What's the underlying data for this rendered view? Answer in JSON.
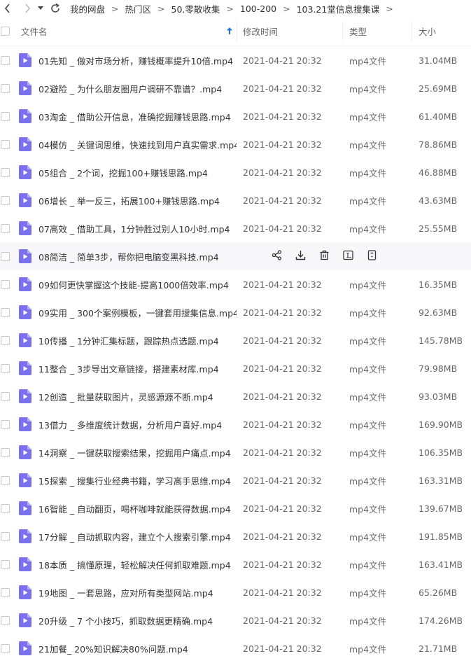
{
  "breadcrumb": [
    "我的网盘",
    "热门区",
    "50.零散收集",
    "100-200",
    "103.21堂信息搜集课"
  ],
  "breadcrumb_separator": ">",
  "columns": {
    "name": "文件名",
    "modified": "修改时间",
    "type": "类型",
    "size": "大小"
  },
  "files": [
    {
      "name": "01先知 _ 做对市场分析，赚钱概率提升10倍.mp4",
      "modified": "2021-04-21 20:32",
      "type": "mp4文件",
      "size": "31.04MB"
    },
    {
      "name": "02避险 _ 为什么朋友圈用户调研不靠谱？.mp4",
      "modified": "2021-04-21 20:32",
      "type": "mp4文件",
      "size": "25.69MB"
    },
    {
      "name": "03淘金 _ 借助公开信息，准确挖掘赚钱思路.mp4",
      "modified": "2021-04-21 20:32",
      "type": "mp4文件",
      "size": "61.40MB"
    },
    {
      "name": "04模仿 _ 关键词思维，快速找到用户真实需求.mp4",
      "modified": "2021-04-21 20:32",
      "type": "mp4文件",
      "size": "78.86MB"
    },
    {
      "name": "05组合 _ 2个词，挖掘100+赚钱思路.mp4",
      "modified": "2021-04-21 20:32",
      "type": "mp4文件",
      "size": "46.88MB"
    },
    {
      "name": "06增长 _ 举一反三，拓展100+赚钱思路.mp4",
      "modified": "2021-04-21 20:32",
      "type": "mp4文件",
      "size": "43.63MB"
    },
    {
      "name": "07高效 _ 借助工具，1分钟胜过别人10小时.mp4",
      "modified": "2021-04-21 20:32",
      "type": "mp4文件",
      "size": "25.55MB"
    },
    {
      "name": "08简洁 _ 简单3步，帮你把电脑变黑科技.mp4",
      "modified": "",
      "type": "",
      "size": "",
      "hover": true
    },
    {
      "name": "09如何更快掌握这个技能-提高1000倍效率.mp4",
      "modified": "2021-04-21 20:32",
      "type": "mp4文件",
      "size": "16.35MB"
    },
    {
      "name": "09实用 _ 300个案例模板，一键套用搜集信息.mp4",
      "modified": "2021-04-21 20:32",
      "type": "mp4文件",
      "size": "92.63MB"
    },
    {
      "name": "10传播 _ 1分钟汇集标题，跟踪热点选题.mp4",
      "modified": "2021-04-21 20:32",
      "type": "mp4文件",
      "size": "145.78MB"
    },
    {
      "name": "11整合 _ 3步导出文章链接，搭建素材库.mp4",
      "modified": "2021-04-21 20:32",
      "type": "mp4文件",
      "size": "79.98MB"
    },
    {
      "name": "12创造 _ 批量获取图片，灵感源源不断.mp4",
      "modified": "2021-04-21 20:32",
      "type": "mp4文件",
      "size": "93.03MB"
    },
    {
      "name": "13借力 _ 多维度统计数据，分析用户喜好.mp4",
      "modified": "2021-04-21 20:32",
      "type": "mp4文件",
      "size": "169.90MB"
    },
    {
      "name": "14洞察 _ 一键获取搜索结果，挖掘用户痛点.mp4",
      "modified": "2021-04-21 20:32",
      "type": "mp4文件",
      "size": "106.35MB"
    },
    {
      "name": "15探索 _ 搜集行业经典书籍，学习高手思维.mp4",
      "modified": "2021-04-21 20:32",
      "type": "mp4文件",
      "size": "163.31MB"
    },
    {
      "name": "16智能 _ 自动翻页，喝杯咖啡就能获得数据.mp4",
      "modified": "2021-04-21 20:32",
      "type": "mp4文件",
      "size": "139.67MB"
    },
    {
      "name": "17分解 _ 自动抓取内容，建立个人搜索引擎.mp4",
      "modified": "2021-04-21 20:32",
      "type": "mp4文件",
      "size": "191.85MB"
    },
    {
      "name": "18本质 _ 搞懂原理，轻松解决任何抓取难题.mp4",
      "modified": "2021-04-21 20:32",
      "type": "mp4文件",
      "size": "163.41MB"
    },
    {
      "name": "19地图 _ 一套思路，应对所有类型网站.mp4",
      "modified": "2021-04-21 20:32",
      "type": "mp4文件",
      "size": "65.26MB"
    },
    {
      "name": "20升级 _ 7 个小技巧，抓取数据更精确.mp4",
      "modified": "2021-04-21 20:32",
      "type": "mp4文件",
      "size": "174.26MB"
    },
    {
      "name": "21加餐_ 20%知识解决80%问题.mp4",
      "modified": "2021-04-21 20:32",
      "type": "mp4文件",
      "size": "21.71MB"
    }
  ],
  "row_actions": [
    "share-icon",
    "download-icon",
    "delete-icon",
    "rename-icon",
    "more-icon"
  ],
  "colors": {
    "file_icon": "#7b70f0",
    "sort_arrow": "#1a73e8",
    "hover_row": "#f7f7f9"
  }
}
